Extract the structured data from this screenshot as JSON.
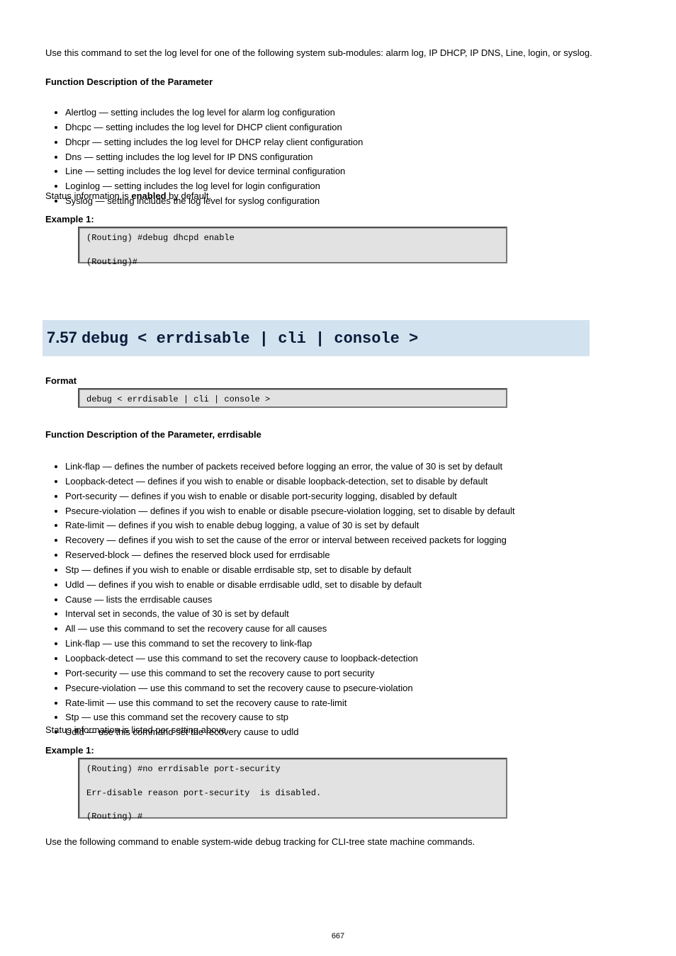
{
  "top_paragraph": "Use this command to set the log level for one of the following system sub-modules: alarm log, IP DHCP, IP DNS, Line, login, or syslog.",
  "func_desc_heading_1": "Function Description of the Parameter",
  "bullets_1": [
    "Alertlog — setting includes the log level for alarm log configuration",
    "Dhcpc — setting includes the log level for DHCP client configuration",
    "Dhcpr — setting includes the log level for DHCP relay client configuration",
    "Dns — setting includes the log level for IP DNS configuration",
    "Line — setting includes the log level for device terminal configuration",
    "Loginlog — setting includes the log level for login configuration",
    "Syslog — setting includes the log level for syslog configuration"
  ],
  "status_info": {
    "prefix": "Status information is ",
    "bold": "enabled",
    "suffix": " by default."
  },
  "example_1": {
    "title": "Example 1:",
    "code": "(Routing) #debug dhcpd enable\n\n(Routing)#"
  },
  "heading": {
    "number": "7.57",
    "text": "debug < errdisable | cli | console >"
  },
  "example_2": {
    "title": "Format",
    "code": "debug < errdisable | cli | console >"
  },
  "func_desc_heading_2": "Function Description of the Parameter, errdisable",
  "bullets_2": [
    "Link-flap — defines the number of packets received before logging an error, the value of 30 is set by default",
    "Loopback-detect — defines if you wish to enable or disable loopback-detection, set to disable by default",
    "Port-security — defines if you wish to enable or disable port-security logging, disabled by default",
    "Psecure-violation — defines if you wish to enable or disable psecure-violation logging, set to disable by default",
    "Rate-limit — defines if you wish to enable debug logging, a value of 30 is set by default",
    "Recovery — defines if you wish to set the cause of the error or interval between received packets for logging",
    "Reserved-block — defines the reserved block used for errdisable",
    "Stp — defines if you wish to enable or disable errdisable stp, set to disable by default",
    "Udld — defines if you wish to enable or disable errdisable udld, set to disable by default",
    "Cause — lists the errdisable causes",
    "Interval set in seconds, the value of 30 is set by default",
    "All — use this command to set the recovery cause for all causes",
    "Link-flap — use this command to set the recovery to link-flap",
    "Loopback-detect — use this command to set the recovery cause to loopback-detection",
    "Port-security — use this command to set the recovery cause to port security",
    "Psecure-violation — use this command to set the recovery cause to psecure-violation",
    "Rate-limit — use this command to set the recovery cause to rate-limit",
    "Stp — use this command set the recovery cause to stp",
    "Udld — use this command set the recovery cause to udld"
  ],
  "status_info_2": "Status information is listed per setting above.",
  "example_3": {
    "title": "Example 1:",
    "code": "(Routing) #no errdisable port-security\n\nErr-disable reason port-security  is disabled.\n\n(Routing) #"
  },
  "example_3_after": "Use the following command to enable system-wide debug tracking for CLI-tree state machine commands.",
  "page_number": "667"
}
